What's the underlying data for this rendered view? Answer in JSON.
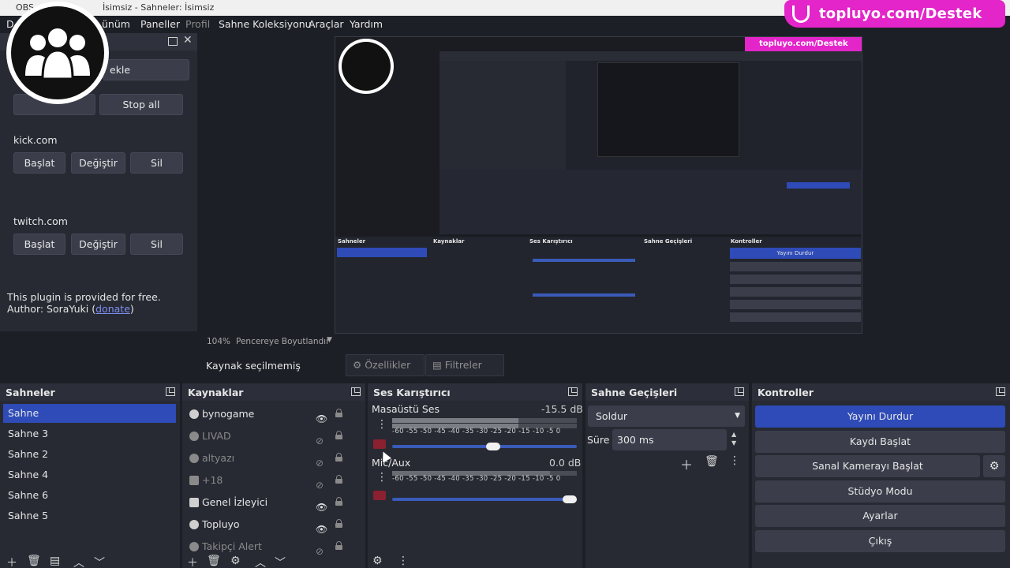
{
  "window": {
    "title_left": "OBS",
    "title_right": "İsimsiz - Sahneler: İsimsiz"
  },
  "menu": {
    "items": [
      {
        "label": "D"
      },
      {
        "label": "ünüm"
      },
      {
        "label": "Paneller"
      },
      {
        "label": "Profil"
      },
      {
        "label": "Sahne Koleksiyonu"
      },
      {
        "label": "Araçlar"
      },
      {
        "label": "Yardım"
      }
    ]
  },
  "brand": {
    "text": "topluyo.com/Destek"
  },
  "dock_left": {
    "add_button_fragment": "ekle",
    "stop_all": "Stop all",
    "kick": {
      "label": "kick.com",
      "start": "Başlat",
      "change": "Değiştir",
      "delete": "Sil"
    },
    "twitch": {
      "label": "twitch.com",
      "start": "Başlat",
      "change": "Değiştir",
      "delete": "Sil"
    },
    "plugin_note": "This plugin is provided for free.",
    "author_prefix": "Author: SoraYuki (",
    "donate": "donate",
    "author_suffix": ")"
  },
  "preview_bar": {
    "zoom": "104%",
    "fit": "Pencereye Boyutlandır"
  },
  "source_bar": {
    "no_source": "Kaynak seçilmemiş",
    "properties": "Özellikler",
    "filters": "Filtreler"
  },
  "scenes": {
    "title": "Sahneler",
    "items": [
      "Sahne",
      "Sahne 3",
      "Sahne 2",
      "Sahne 4",
      "Sahne 6",
      "Sahne 5"
    ]
  },
  "sources": {
    "title": "Kaynaklar",
    "items": [
      {
        "name": "bynogame",
        "visible": true,
        "locked": false
      },
      {
        "name": "LIVAD",
        "visible": false,
        "locked": true
      },
      {
        "name": "altyazı",
        "visible": false,
        "locked": false
      },
      {
        "name": "+18",
        "visible": false,
        "locked": false
      },
      {
        "name": "Genel İzleyici",
        "visible": true,
        "locked": false
      },
      {
        "name": "Topluyo",
        "visible": true,
        "locked": false
      },
      {
        "name": "Takipçi Alert",
        "visible": false,
        "locked": false
      }
    ]
  },
  "mixer": {
    "title": "Ses Karıştırıcı",
    "channels": [
      {
        "name": "Masaüstü Ses",
        "db": "-15.5 dB",
        "volume": 0.55
      },
      {
        "name": "Mic/Aux",
        "db": "0.0 dB",
        "volume": 1.0
      }
    ],
    "ticks": "-60 -55 -50 -45 -40 -35 -30 -25 -20 -15 -10 -5 0"
  },
  "transitions": {
    "title": "Sahne Geçişleri",
    "selected": "Soldur",
    "duration_label": "Süre",
    "duration_value": "300 ms"
  },
  "controls": {
    "title": "Kontroller",
    "stop_stream": "Yayını Durdur",
    "start_record": "Kaydı Başlat",
    "start_vcam": "Sanal Kamerayı Başlat",
    "studio_mode": "Stüdyo Modu",
    "settings": "Ayarlar",
    "exit": "Çıkış"
  },
  "preview_mirror": {
    "brand": "topluyo.com/Destek",
    "scenes_title": "Sahneler",
    "sources_title": "Kaynaklar",
    "mixer_title": "Ses Karıştırıcı",
    "transitions_title": "Sahne Geçişleri",
    "controls_title": "Kontroller",
    "stop_stream": "Yayını Durdur"
  }
}
